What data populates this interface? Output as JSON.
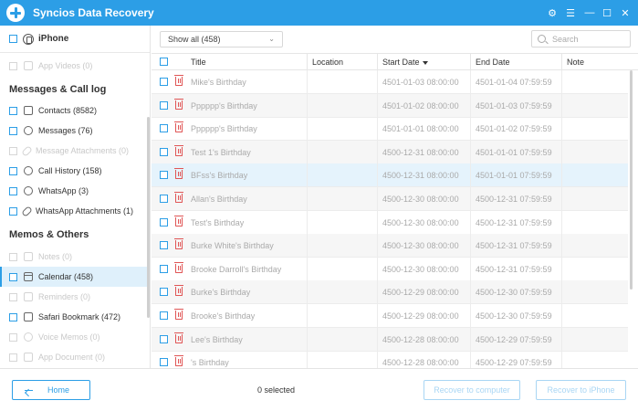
{
  "app": {
    "title": "Syncios Data Recovery"
  },
  "titlebar": {
    "icons": [
      "gear-icon",
      "menu-icon",
      "minimize-icon",
      "maximize-icon",
      "close-icon"
    ]
  },
  "sidebar": {
    "device": "iPhone",
    "items_top": [
      {
        "label": "App Videos (0)",
        "disabled": true
      }
    ],
    "section_messages": "Messages & Call log",
    "messages_items": [
      {
        "label": "Contacts (8582)",
        "icon": "contacts-icon",
        "disabled": false
      },
      {
        "label": "Messages (76)",
        "icon": "message-icon",
        "disabled": false
      },
      {
        "label": "Message Attachments (0)",
        "icon": "attachment-icon",
        "disabled": true
      },
      {
        "label": "Call History (158)",
        "icon": "phone-icon",
        "disabled": false
      },
      {
        "label": "WhatsApp (3)",
        "icon": "whatsapp-icon",
        "disabled": false
      },
      {
        "label": "WhatsApp Attachments (1)",
        "icon": "attachment-icon",
        "disabled": false
      }
    ],
    "section_memos": "Memos & Others",
    "memos_items": [
      {
        "label": "Notes (0)",
        "icon": "notes-icon",
        "disabled": true
      },
      {
        "label": "Calendar (458)",
        "icon": "calendar-icon",
        "disabled": false,
        "active": true
      },
      {
        "label": "Reminders (0)",
        "icon": "reminders-icon",
        "disabled": true
      },
      {
        "label": "Safari Bookmark (472)",
        "icon": "bookmark-icon",
        "disabled": false
      },
      {
        "label": "Voice Memos (0)",
        "icon": "voice-memo-icon",
        "disabled": true
      },
      {
        "label": "App Document (0)",
        "icon": "document-icon",
        "disabled": true
      }
    ]
  },
  "toolbar": {
    "filter": "Show all (458)",
    "search_placeholder": "Search"
  },
  "table": {
    "columns": [
      "Title",
      "Location",
      "Start Date",
      "End Date",
      "Note"
    ],
    "sort_column": "Start Date",
    "rows": [
      {
        "title": "Mike's Birthday",
        "location": "",
        "start": "4501-01-03 08:00:00",
        "end": "4501-01-04 07:59:59",
        "note": ""
      },
      {
        "title": "Pppppp's Birthday",
        "location": "",
        "start": "4501-01-02 08:00:00",
        "end": "4501-01-03 07:59:59",
        "note": ""
      },
      {
        "title": "Pppppp's Birthday",
        "location": "",
        "start": "4501-01-01 08:00:00",
        "end": "4501-01-02 07:59:59",
        "note": ""
      },
      {
        "title": "Test 1's Birthday",
        "location": "",
        "start": "4500-12-31 08:00:00",
        "end": "4501-01-01 07:59:59",
        "note": ""
      },
      {
        "title": "BFss's Birthday",
        "location": "",
        "start": "4500-12-31 08:00:00",
        "end": "4501-01-01 07:59:59",
        "note": "",
        "selected": true
      },
      {
        "title": "Allan's Birthday",
        "location": "",
        "start": "4500-12-30 08:00:00",
        "end": "4500-12-31 07:59:59",
        "note": ""
      },
      {
        "title": "Test's Birthday",
        "location": "",
        "start": "4500-12-30 08:00:00",
        "end": "4500-12-31 07:59:59",
        "note": ""
      },
      {
        "title": "Burke White's Birthday",
        "location": "",
        "start": "4500-12-30 08:00:00",
        "end": "4500-12-31 07:59:59",
        "note": ""
      },
      {
        "title": "Brooke Darroll's Birthday",
        "location": "",
        "start": "4500-12-30 08:00:00",
        "end": "4500-12-31 07:59:59",
        "note": ""
      },
      {
        "title": "Burke's Birthday",
        "location": "",
        "start": "4500-12-29 08:00:00",
        "end": "4500-12-30 07:59:59",
        "note": ""
      },
      {
        "title": "Brooke's Birthday",
        "location": "",
        "start": "4500-12-29 08:00:00",
        "end": "4500-12-30 07:59:59",
        "note": ""
      },
      {
        "title": "Lee's Birthday",
        "location": "",
        "start": "4500-12-28 08:00:00",
        "end": "4500-12-29 07:59:59",
        "note": ""
      },
      {
        "title": "'s Birthday",
        "location": "",
        "start": "4500-12-28 08:00:00",
        "end": "4500-12-29 07:59:59",
        "note": ""
      }
    ]
  },
  "footer": {
    "home_label": "Home",
    "selected_text": "0 selected",
    "recover_computer_label": "Recover to computer",
    "recover_iphone_label": "Recover to iPhone"
  },
  "colors": {
    "accent": "#2c9ee6",
    "selected_row": "#e5f3fc",
    "delete": "#e05555"
  }
}
